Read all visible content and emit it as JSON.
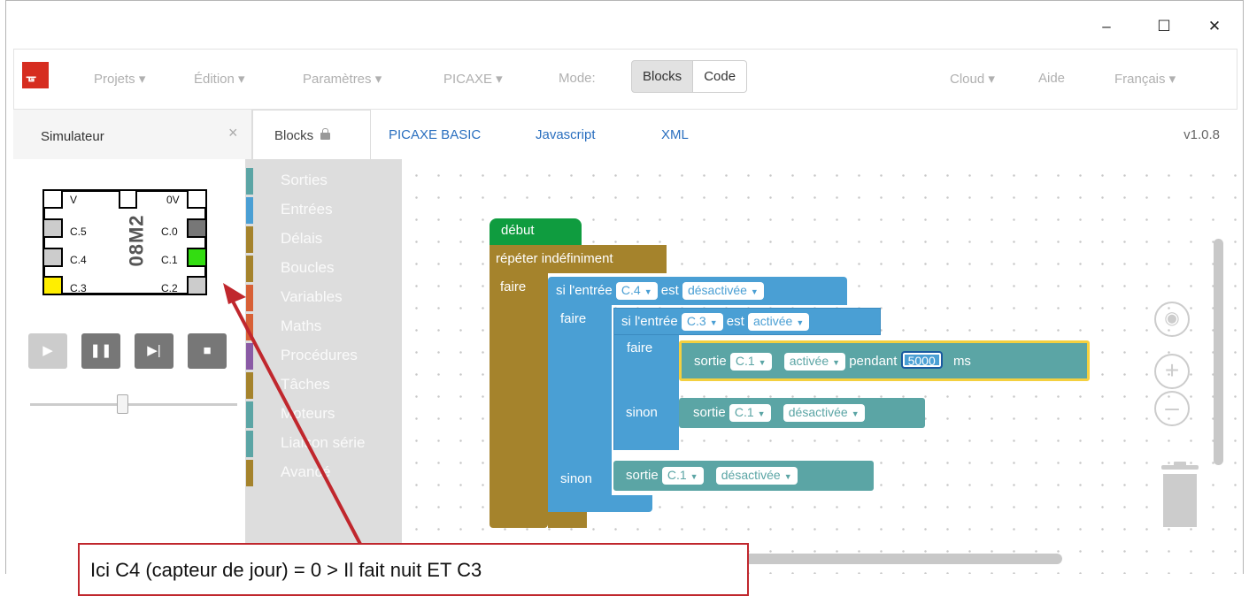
{
  "window": {
    "minimize": "–",
    "maximize": "☐",
    "close": "✕"
  },
  "navbar": {
    "menus": [
      "Projets ▾",
      "Édition ▾",
      "Paramètres ▾",
      "PICAXE ▾",
      "Mode:"
    ],
    "mode_blocks": "Blocks",
    "mode_code": "Code",
    "right_menus": [
      "Cloud ▾",
      "Aide",
      "Français ▾"
    ]
  },
  "simulator": {
    "tab_title": "Simulateur",
    "close": "×",
    "chip_name": "08M2",
    "pins_left": [
      "V",
      "C.5",
      "C.4",
      "C.3"
    ],
    "pins_right": [
      "0V",
      "C.0",
      "C.1",
      "C.2"
    ],
    "colors": {
      "green": "#33dd11",
      "yellow": "#ffee00",
      "gray": "#cccccc",
      "dark": "#777777"
    }
  },
  "editor": {
    "tab_blocks": "Blocks",
    "tabs": [
      "PICAXE BASIC",
      "Javascript",
      "XML"
    ],
    "version": "v1.0.8"
  },
  "toolbox": [
    {
      "label": "Sorties",
      "color": "#5ba5a5"
    },
    {
      "label": "Entrées",
      "color": "#4a9fd4"
    },
    {
      "label": "Délais",
      "color": "#a5832c"
    },
    {
      "label": "Boucles",
      "color": "#a5832c"
    },
    {
      "label": "Variables",
      "color": "#d86036"
    },
    {
      "label": "Maths",
      "color": "#d86036"
    },
    {
      "label": "Procédures",
      "color": "#8a5aa5"
    },
    {
      "label": "Tâches",
      "color": "#a5832c"
    },
    {
      "label": "Moteurs",
      "color": "#5ba5a5"
    },
    {
      "label": "Liaison série",
      "color": "#5ba5a5"
    },
    {
      "label": "Avancé",
      "color": "#a5832c"
    }
  ],
  "program": {
    "start": "début",
    "loop": "répéter indéfiniment",
    "do": "faire",
    "if1": {
      "text": "si l'entrée",
      "pin": "C.4",
      "is": "est",
      "state": "désactivée"
    },
    "if2": {
      "text": "si l'entrée",
      "pin": "C.3",
      "is": "est",
      "state": "activée"
    },
    "out1": {
      "text": "sortie",
      "pin": "C.1",
      "state": "activée",
      "during": "pendant",
      "value": "5000",
      "unit": "ms"
    },
    "else": "sinon",
    "out2": {
      "text": "sortie",
      "pin": "C.1",
      "state": "désactivée"
    },
    "out3": {
      "text": "sortie",
      "pin": "C.1",
      "state": "désactivée"
    }
  },
  "annotation": "Ici C4 (capteur de jour) = 0 > Il fait nuit ET C3"
}
